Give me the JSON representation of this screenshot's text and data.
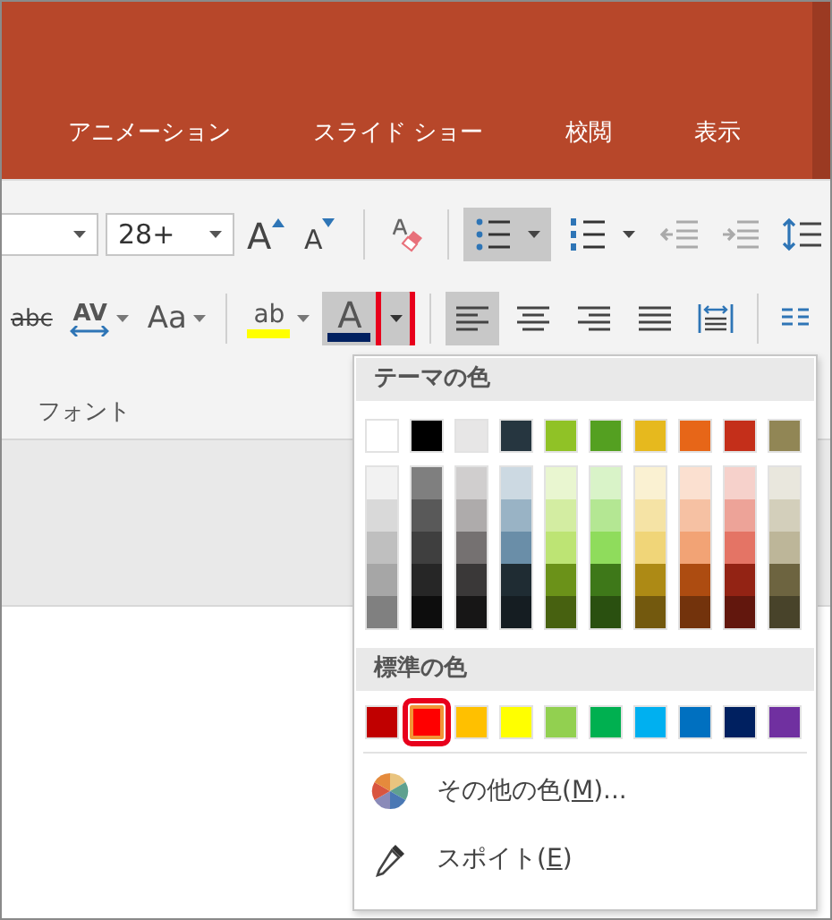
{
  "tabs": [
    {
      "label": "アニメーション"
    },
    {
      "label": "スライド ショー"
    },
    {
      "label": "校閲"
    },
    {
      "label": "表示"
    }
  ],
  "ribbon": {
    "row1": [
      {
        "kind": "font-name"
      },
      {
        "kind": "font-size",
        "value": "28+"
      },
      {
        "kind": "grow",
        "label": "A"
      },
      {
        "kind": "shrink",
        "label": "A"
      },
      {
        "kind": "separator"
      },
      {
        "kind": "clear"
      },
      {
        "kind": "separator"
      },
      {
        "kind": "bullets",
        "selected": true
      },
      {
        "kind": "numbering",
        "selected": false
      },
      {
        "kind": "decrease-indent"
      },
      {
        "kind": "increase-indent"
      },
      {
        "kind": "line-spacing"
      }
    ],
    "row2": [
      {
        "kind": "strike",
        "label": "abc"
      },
      {
        "kind": "spacing",
        "label": "AV"
      },
      {
        "kind": "case",
        "label": "Aa"
      },
      {
        "kind": "separator"
      },
      {
        "kind": "highlight",
        "label": "ab"
      },
      {
        "kind": "font-color",
        "label": "A",
        "selected": true,
        "highlighted": true
      },
      {
        "kind": "separator"
      },
      {
        "kind": "align-left",
        "selected": true
      },
      {
        "kind": "align-center",
        "selected": false
      },
      {
        "kind": "align-right",
        "selected": false
      },
      {
        "kind": "justify",
        "selected": false
      },
      {
        "kind": "distribute",
        "selected": false
      },
      {
        "kind": "separator"
      },
      {
        "kind": "columns"
      }
    ],
    "group_label": "フォント"
  },
  "color_menu": {
    "theme_header": "テーマの色",
    "theme_colors": [
      {
        "color": "#ffffff",
        "shades": [
          {
            "color": "#f2f2f2"
          },
          {
            "color": "#d9d9d9"
          },
          {
            "color": "#bfbfbf"
          },
          {
            "color": "#a6a6a6"
          },
          {
            "color": "#808080"
          }
        ]
      },
      {
        "color": "#000000",
        "shades": [
          {
            "color": "#7f7f7f"
          },
          {
            "color": "#595959"
          },
          {
            "color": "#3f3f3f"
          },
          {
            "color": "#262626"
          },
          {
            "color": "#0d0d0d"
          }
        ]
      },
      {
        "color": "#e7e6e6",
        "shades": [
          {
            "color": "#d0cece"
          },
          {
            "color": "#aeabab"
          },
          {
            "color": "#757171"
          },
          {
            "color": "#3a3838"
          },
          {
            "color": "#171616"
          }
        ]
      },
      {
        "color": "#263640",
        "shades": [
          {
            "color": "#ccd9e2"
          },
          {
            "color": "#99b3c5"
          },
          {
            "color": "#6a8ea8"
          },
          {
            "color": "#1f2c33"
          },
          {
            "color": "#151d22"
          }
        ]
      },
      {
        "color": "#90c226",
        "shades": [
          {
            "color": "#e9f6d0"
          },
          {
            "color": "#d3eda2"
          },
          {
            "color": "#bde474"
          },
          {
            "color": "#6b9219"
          },
          {
            "color": "#476110"
          }
        ]
      },
      {
        "color": "#54a021",
        "shades": [
          {
            "color": "#d9f3c8"
          },
          {
            "color": "#b4e793"
          },
          {
            "color": "#8fdc5c"
          },
          {
            "color": "#3e7819"
          },
          {
            "color": "#2a5010"
          }
        ]
      },
      {
        "color": "#e6b91e",
        "shades": [
          {
            "color": "#faf1d2"
          },
          {
            "color": "#f5e3a5"
          },
          {
            "color": "#f0d578"
          },
          {
            "color": "#ad8a15"
          },
          {
            "color": "#73590e"
          }
        ]
      },
      {
        "color": "#e76618",
        "shades": [
          {
            "color": "#fbe0d0"
          },
          {
            "color": "#f6c1a3"
          },
          {
            "color": "#f2a375"
          },
          {
            "color": "#ad4c11"
          },
          {
            "color": "#73330c"
          }
        ]
      },
      {
        "color": "#c42f1a",
        "shades": [
          {
            "color": "#f6d1cb"
          },
          {
            "color": "#eda398"
          },
          {
            "color": "#e47465"
          },
          {
            "color": "#932314"
          },
          {
            "color": "#62170d"
          }
        ]
      },
      {
        "color": "#918655",
        "shades": [
          {
            "color": "#e9e7dd"
          },
          {
            "color": "#d3cfbb"
          },
          {
            "color": "#bdb699"
          },
          {
            "color": "#6d6440"
          },
          {
            "color": "#48432a"
          }
        ]
      }
    ],
    "standard_header": "標準の色",
    "standard_colors": [
      {
        "color": "#c00000",
        "selected": false
      },
      {
        "color": "#ff0000",
        "selected": true
      },
      {
        "color": "#ffc000",
        "selected": false
      },
      {
        "color": "#ffff00",
        "selected": false
      },
      {
        "color": "#92d050",
        "selected": false
      },
      {
        "color": "#00b050",
        "selected": false
      },
      {
        "color": "#00b0f0",
        "selected": false
      },
      {
        "color": "#0070c0",
        "selected": false
      },
      {
        "color": "#002060",
        "selected": false
      },
      {
        "color": "#7030a0",
        "selected": false
      }
    ],
    "items": [
      {
        "kind": "more-colors",
        "label_before": "その他の色(",
        "access_key": "M",
        "label_after": ")..."
      },
      {
        "kind": "eyedropper",
        "label_before": "スポイト(",
        "access_key": "E",
        "label_after": ")"
      }
    ]
  }
}
